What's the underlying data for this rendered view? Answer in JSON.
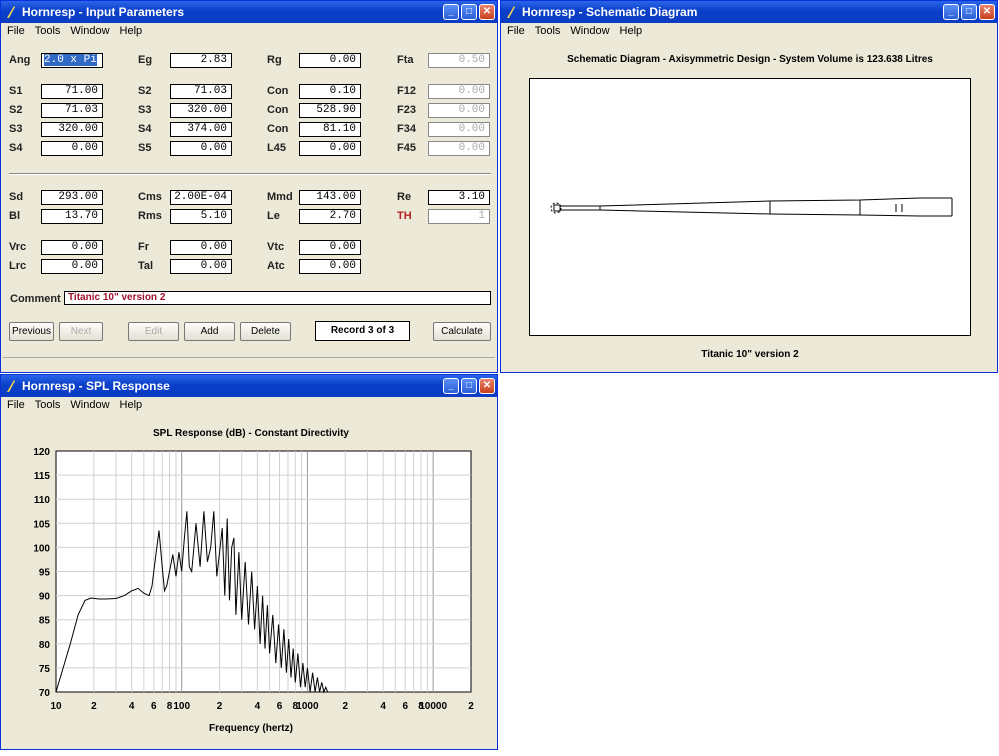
{
  "menu": [
    "File",
    "Tools",
    "Window",
    "Help"
  ],
  "input_window": {
    "title": "Hornresp - Input Parameters",
    "params": [
      {
        "label": "Ang",
        "value": "2.0 x Pi",
        "state": "selected"
      },
      {
        "label": "Eg",
        "value": "2.83"
      },
      {
        "label": "Rg",
        "value": "0.00"
      },
      {
        "label": "Fta",
        "value": "0.50",
        "state": "disabled"
      },
      {
        "label": "S1",
        "value": "71.00"
      },
      {
        "label": "S2",
        "value": "71.03"
      },
      {
        "label": "Con",
        "value": "0.10"
      },
      {
        "label": "F12",
        "value": "0.00",
        "state": "disabled"
      },
      {
        "label": "S2",
        "value": "71.03"
      },
      {
        "label": "S3",
        "value": "320.00"
      },
      {
        "label": "Con",
        "value": "528.90"
      },
      {
        "label": "F23",
        "value": "0.00",
        "state": "disabled"
      },
      {
        "label": "S3",
        "value": "320.00"
      },
      {
        "label": "S4",
        "value": "374.00"
      },
      {
        "label": "Con",
        "value": "81.10"
      },
      {
        "label": "F34",
        "value": "0.00",
        "state": "disabled"
      },
      {
        "label": "S4",
        "value": "0.00"
      },
      {
        "label": "S5",
        "value": "0.00"
      },
      {
        "label": "L45",
        "value": "0.00"
      },
      {
        "label": "F45",
        "value": "0.00",
        "state": "disabled"
      },
      {
        "label": "Sd",
        "value": "293.00"
      },
      {
        "label": "Cms",
        "value": "2.00E-04"
      },
      {
        "label": "Mmd",
        "value": "143.00"
      },
      {
        "label": "Re",
        "value": "3.10"
      },
      {
        "label": "Bl",
        "value": "13.70"
      },
      {
        "label": "Rms",
        "value": "5.10"
      },
      {
        "label": "Le",
        "value": "2.70"
      },
      {
        "label": "TH",
        "value": "1",
        "state": "disabled",
        "label_color": "red"
      },
      {
        "label": "Vrc",
        "value": "0.00"
      },
      {
        "label": "Fr",
        "value": "0.00"
      },
      {
        "label": "Vtc",
        "value": "0.00"
      },
      {
        "label": "Lrc",
        "value": "0.00"
      },
      {
        "label": "Tal",
        "value": "0.00"
      },
      {
        "label": "Atc",
        "value": "0.00"
      }
    ],
    "comment_label": "Comment",
    "comment_value": "Titanic 10\" version 2",
    "buttons": {
      "previous": "Previous",
      "next": "Next",
      "edit": "Edit",
      "add": "Add",
      "delete": "Delete",
      "calculate": "Calculate"
    },
    "record": "Record 3 of 3"
  },
  "schematic_window": {
    "title": "Hornresp - Schematic Diagram",
    "heading": "Schematic Diagram - Axisymmetric Design - System Volume is 123.638 Litres",
    "caption": "Titanic 10\" version 2"
  },
  "spl_window": {
    "title": "Hornresp - SPL Response"
  },
  "chart_data": {
    "type": "line",
    "title": "SPL Response (dB) - Constant Directivity",
    "xlabel": "Frequency (hertz)",
    "ylabel": "",
    "x_scale": "log",
    "xlim": [
      10,
      20000
    ],
    "ylim": [
      70,
      120
    ],
    "yticks": [
      120,
      115,
      110,
      105,
      100,
      95,
      90,
      85,
      80,
      75,
      70
    ],
    "xtick_labels": [
      {
        "value": 10,
        "label": "10"
      },
      {
        "value": 20,
        "label": "2"
      },
      {
        "value": 40,
        "label": "4"
      },
      {
        "value": 60,
        "label": "6"
      },
      {
        "value": 80,
        "label": "8"
      },
      {
        "value": 100,
        "label": "100"
      },
      {
        "value": 200,
        "label": "2"
      },
      {
        "value": 400,
        "label": "4"
      },
      {
        "value": 600,
        "label": "6"
      },
      {
        "value": 800,
        "label": "8"
      },
      {
        "value": 1000,
        "label": "1000"
      },
      {
        "value": 2000,
        "label": "2"
      },
      {
        "value": 4000,
        "label": "4"
      },
      {
        "value": 6000,
        "label": "6"
      },
      {
        "value": 8000,
        "label": "8"
      },
      {
        "value": 10000,
        "label": "10000"
      },
      {
        "value": 20000,
        "label": "2"
      }
    ],
    "grid": true,
    "series": [
      {
        "x": [
          10,
          13,
          15,
          17,
          19,
          22,
          25,
          30,
          35,
          40,
          45,
          50,
          55,
          58,
          62,
          66,
          70,
          73,
          76,
          80,
          85,
          90,
          95,
          100,
          105,
          110,
          115,
          120,
          125,
          130,
          140,
          150,
          160,
          170,
          180,
          190,
          200,
          210,
          220,
          230,
          240,
          250,
          260,
          270,
          285,
          300,
          320,
          340,
          360,
          380,
          400,
          420,
          440,
          460,
          480,
          500,
          530,
          560,
          590,
          620,
          650,
          680,
          710,
          740,
          770,
          800,
          840,
          880,
          920,
          960,
          1000,
          1050,
          1100,
          1150,
          1200,
          1250,
          1300,
          1350,
          1400,
          1450,
          1500
        ],
        "y": [
          70,
          80,
          86,
          89,
          89.5,
          89.3,
          89.3,
          89.4,
          90,
          91,
          91.5,
          90.5,
          90,
          92,
          98,
          103.5,
          96,
          91,
          92,
          95,
          98.5,
          94,
          99,
          95,
          102,
          107.5,
          96,
          95,
          100,
          105,
          96,
          107.5,
          97,
          100,
          107.5,
          94,
          99,
          104,
          90,
          106,
          89,
          100,
          102,
          86,
          99,
          85,
          97,
          84,
          95,
          83,
          92,
          80,
          90,
          79,
          88,
          78,
          86,
          76,
          84,
          75,
          83,
          74,
          81,
          73,
          79,
          72,
          78,
          71,
          76,
          71,
          75,
          70,
          74,
          70,
          73,
          70,
          72,
          70,
          71,
          70,
          70
        ]
      }
    ]
  }
}
